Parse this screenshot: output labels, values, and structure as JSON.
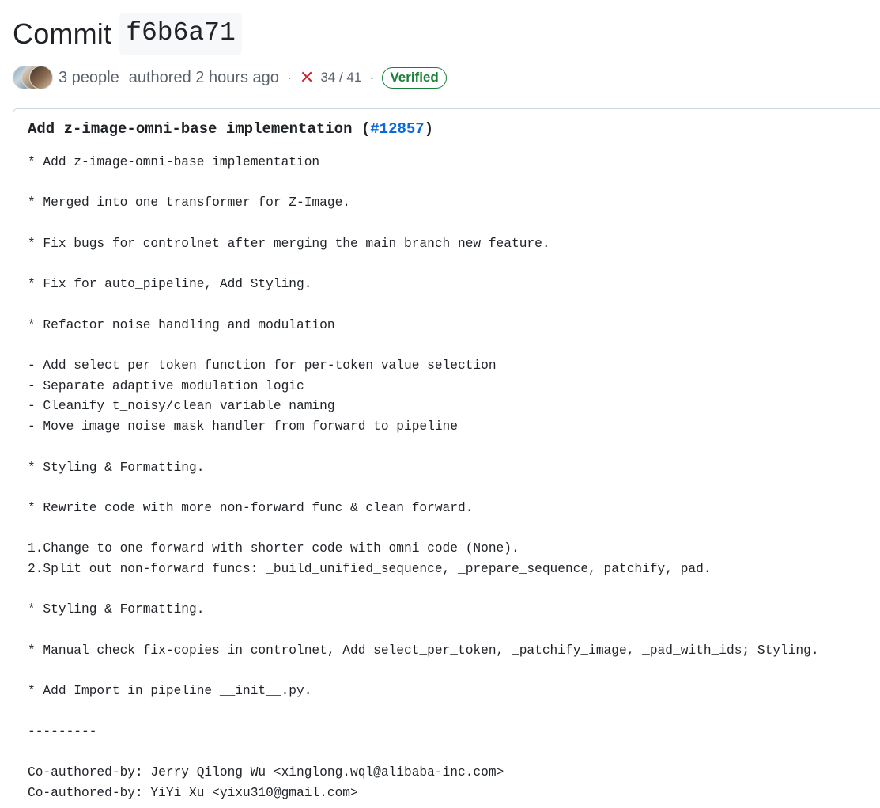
{
  "header": {
    "title_word": "Commit",
    "sha": "f6b6a71"
  },
  "meta": {
    "people_label": "3 people",
    "authored_label": "authored 2 hours ago",
    "separator": "·",
    "status_icon": "x-icon",
    "checks_label": "34 / 41",
    "verified_label": "Verified",
    "colors": {
      "failed": "#d1242f",
      "verified": "#1a7f37",
      "link": "#0969da"
    }
  },
  "commit": {
    "title_prefix": "Add z-image-omni-base implementation (",
    "pr_number": "#12857",
    "title_suffix": ")",
    "body": "* Add z-image-omni-base implementation\n\n* Merged into one transformer for Z-Image.\n\n* Fix bugs for controlnet after merging the main branch new feature.\n\n* Fix for auto_pipeline, Add Styling.\n\n* Refactor noise handling and modulation\n\n- Add select_per_token function for per-token value selection\n- Separate adaptive modulation logic\n- Cleanify t_noisy/clean variable naming\n- Move image_noise_mask handler from forward to pipeline\n\n* Styling & Formatting.\n\n* Rewrite code with more non-forward func & clean forward.\n\n1.Change to one forward with shorter code with omni code (None).\n2.Split out non-forward funcs: _build_unified_sequence, _prepare_sequence, patchify, pad.\n\n* Styling & Formatting.\n\n* Manual check fix-copies in controlnet, Add select_per_token, _patchify_image, _pad_with_ids; Styling.\n\n* Add Import in pipeline __init__.py.\n\n---------\n\nCo-authored-by: Jerry Qilong Wu <xinglong.wql@alibaba-inc.com>\nCo-authored-by: YiYi Xu <yixu310@gmail.com>"
  }
}
